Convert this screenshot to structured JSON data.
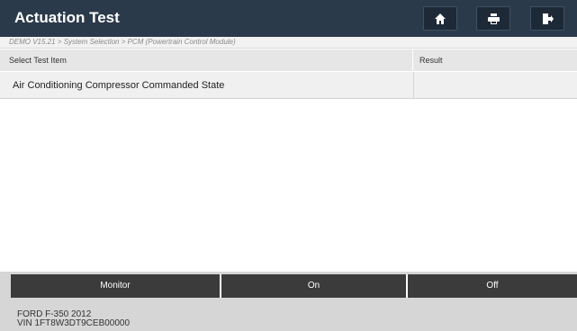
{
  "header": {
    "title": "Actuation Test",
    "buttons": [
      {
        "name": "home-button",
        "icon": "home-icon"
      },
      {
        "name": "print-button",
        "icon": "printer-icon"
      },
      {
        "name": "exit-button",
        "icon": "exit-icon"
      }
    ]
  },
  "breadcrumb": "DEMO V15.21 > System Selection > PCM (Powertrain Control Module)",
  "table": {
    "columns": [
      "Select Test Item",
      "Result"
    ],
    "rows": [
      {
        "item": "Air Conditioning Compressor Commanded State",
        "result": ""
      }
    ]
  },
  "actions": [
    "Monitor",
    "On",
    "Off"
  ],
  "vehicle": {
    "model": "FORD F-350 2012",
    "vin": "VIN 1FT8W3DT9CEB00000"
  },
  "colors": {
    "title_bar": "#2b3a4b",
    "button_bg": "#1d2936",
    "action_bar": "#3b3b3b",
    "footer_bg": "#d6d6d6"
  }
}
